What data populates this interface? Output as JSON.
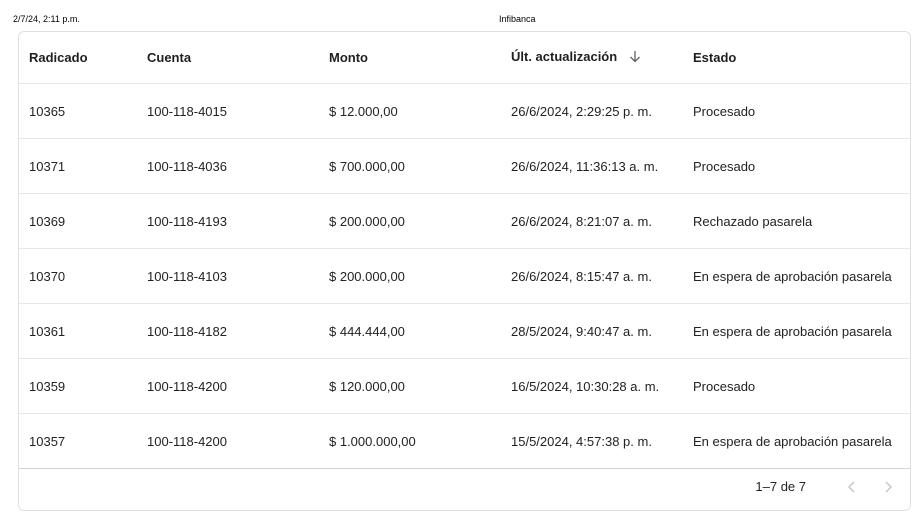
{
  "print_header": {
    "date": "2/7/24, 2:11 p.m.",
    "title": "Infibanca"
  },
  "table": {
    "columns": [
      {
        "label": "Radicado"
      },
      {
        "label": "Cuenta"
      },
      {
        "label": "Monto"
      },
      {
        "label": "Últ. actualización",
        "sort": "descending"
      },
      {
        "label": "Estado"
      }
    ],
    "rows": [
      {
        "radicado": "10365",
        "cuenta": "100-118-4015",
        "monto": "$ 12.000,00",
        "actualizacion": "26/6/2024, 2:29:25 p. m.",
        "estado": "Procesado"
      },
      {
        "radicado": "10371",
        "cuenta": "100-118-4036",
        "monto": "$ 700.000,00",
        "actualizacion": "26/6/2024, 11:36:13 a. m.",
        "estado": "Procesado"
      },
      {
        "radicado": "10369",
        "cuenta": "100-118-4193",
        "monto": "$ 200.000,00",
        "actualizacion": "26/6/2024, 8:21:07 a. m.",
        "estado": "Rechazado pasarela"
      },
      {
        "radicado": "10370",
        "cuenta": "100-118-4103",
        "monto": "$ 200.000,00",
        "actualizacion": "26/6/2024, 8:15:47 a. m.",
        "estado": "En espera de aprobación pasarela"
      },
      {
        "radicado": "10361",
        "cuenta": "100-118-4182",
        "monto": "$ 444.444,00",
        "actualizacion": "28/5/2024, 9:40:47 a. m.",
        "estado": "En espera de aprobación pasarela"
      },
      {
        "radicado": "10359",
        "cuenta": "100-118-4200",
        "monto": "$ 120.000,00",
        "actualizacion": "16/5/2024, 10:30:28 a. m.",
        "estado": "Procesado"
      },
      {
        "radicado": "10357",
        "cuenta": "100-118-4200",
        "monto": "$ 1.000.000,00",
        "actualizacion": "15/5/2024, 4:57:38 p. m.",
        "estado": "En espera de aprobación pasarela"
      }
    ]
  },
  "pagination": {
    "range": "1–7 de 7",
    "prev_icon": "chevron-left-icon",
    "next_icon": "chevron-right-icon",
    "prev_disabled": true,
    "next_disabled": true
  },
  "colors": {
    "border": "#e0e0e0",
    "disabled_icon": "#c4c4c4",
    "text": "#202124"
  }
}
